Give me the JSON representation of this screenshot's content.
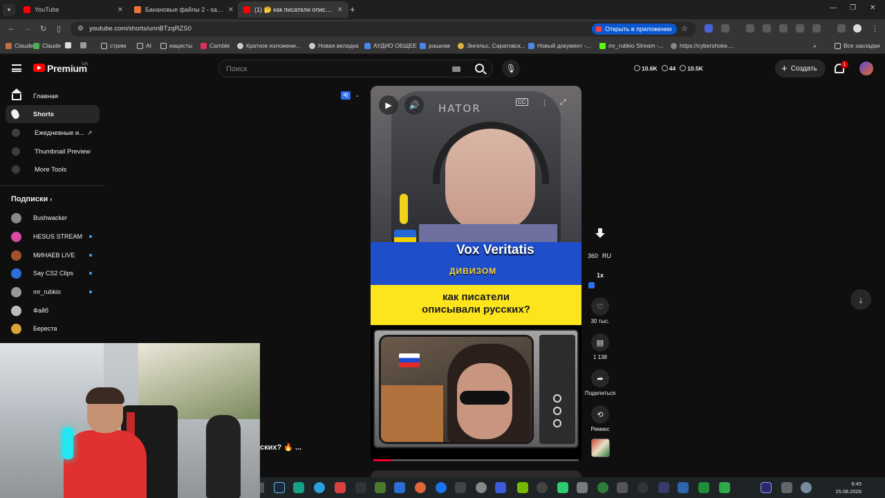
{
  "browser": {
    "tabs": [
      {
        "title": "YouTube",
        "active": false
      },
      {
        "title": "Банановые файлы 2 - sansgot",
        "active": false
      },
      {
        "title": "(1) 🤔 как писатели описывал",
        "active": true
      }
    ],
    "url": "youtube.com/shorts/unnBTzqRZS0",
    "open_in_app": "Открыть в приложении",
    "bookmarks": [
      "Claude",
      "Claude",
      "стрим",
      "AI",
      "нацисты",
      "Camble",
      "Краткое изложени...",
      "Новая вкладка",
      "АУДИО ОБЩЕЕ",
      "рашизм",
      "Энгельс, Саратовск...",
      "Новый документ -...",
      "mr_rubkio Stream -...",
      "https://cybershoke...."
    ],
    "all_bookmarks": "Все закладки"
  },
  "masthead": {
    "logo": "Premium",
    "region": "UA",
    "search_placeholder": "Поиск",
    "stats": [
      "10.6K",
      "44",
      "10.5K"
    ],
    "create_label": "Создать",
    "notif_count": "1"
  },
  "sidebar": {
    "items": [
      {
        "label": "Главная",
        "icon": "home-icon",
        "active": false
      },
      {
        "label": "Shorts",
        "icon": "shorts-icon",
        "active": true
      },
      {
        "label": "Ежедневные и...",
        "icon": "extension-icon",
        "active": false
      },
      {
        "label": "Thumbnail Preview",
        "icon": "extension-icon",
        "active": false
      },
      {
        "label": "More Tools",
        "icon": "extension-icon",
        "active": false
      }
    ],
    "subs_title": "Подписки",
    "subscriptions": [
      {
        "name": "Bushwacker",
        "live": false,
        "color": "#8a8a8a"
      },
      {
        "name": "HESUS STREAM",
        "live": true,
        "color": "#d94aa4"
      },
      {
        "name": "МИНАЕВ LIVE",
        "live": true,
        "color": "#a0522d"
      },
      {
        "name": "Say CS2 Clips",
        "live": true,
        "color": "#2d6fd6"
      },
      {
        "name": "mr_rubkio",
        "live": true,
        "color": "#9a9a9a"
      },
      {
        "name": "Файб",
        "live": false,
        "color": "#bdbdbd"
      },
      {
        "name": "Береста",
        "live": false,
        "color": "#d8a33a"
      }
    ]
  },
  "short": {
    "brand": "HATOR",
    "channel_banner": "Vox Veritatis",
    "subtitle": "ДИВИЗОМ",
    "question_line1": "как писатели",
    "question_line2": "описывали русских?",
    "title_overlay": "ских? 🔥 ...",
    "progress": 0.09
  },
  "actions": {
    "quality": "360",
    "lang": "RU",
    "speed": "1x",
    "likes": "30 тыс.",
    "comments": "1 138",
    "share": "Поделиться",
    "remix": "Ремикс"
  },
  "taskbar": {
    "time": "6:45",
    "date": "25.08.2026"
  },
  "colors": {
    "yt_red": "#ff0000",
    "accent_blue": "#0b57d0",
    "progress_red": "#ff0033"
  }
}
